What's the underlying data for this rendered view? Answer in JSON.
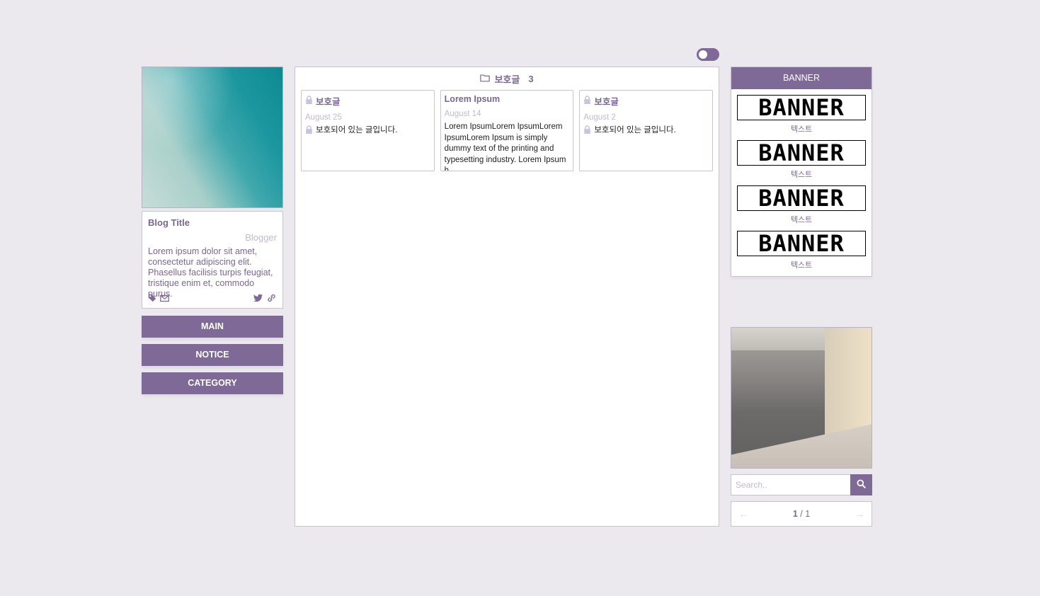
{
  "profile": {
    "blog_title": "Blog Title",
    "blogger": "Blogger",
    "description": "Lorem ipsum dolor sit amet, consectetur adipiscing elit. Phasellus facilisis turpis feugiat, tristique enim et, commodo purus."
  },
  "nav": {
    "main": "MAIN",
    "notice": "NOTICE",
    "category": "CATEGORY"
  },
  "category_header": {
    "name": "보호글",
    "count": "3"
  },
  "posts": [
    {
      "title": "보호글",
      "date": "August 25",
      "body": "보호되어 있는 글입니다."
    },
    {
      "title": "Lorem Ipsum",
      "date": "August 14",
      "body": "Lorem IpsumLorem IpsumLorem IpsumLorem Ipsum is simply dummy text of the printing and typesetting industry. Lorem Ipsum h..."
    },
    {
      "title": "보호글",
      "date": "August 2",
      "body": "보호되어 있는 글입니다."
    }
  ],
  "banner": {
    "header": "BANNER",
    "items": [
      {
        "image_text": "BANNER",
        "caption": "텍스트"
      },
      {
        "image_text": "BANNER",
        "caption": "텍스트"
      },
      {
        "image_text": "BANNER",
        "caption": "텍스트"
      },
      {
        "image_text": "BANNER",
        "caption": "텍스트"
      }
    ]
  },
  "search": {
    "placeholder": "Search.."
  },
  "pager": {
    "current": "1",
    "separator": "/",
    "total": "1"
  },
  "colors": {
    "accent": "#7f6a97",
    "background": "#ece9ee",
    "muted": "#c2bad0"
  }
}
